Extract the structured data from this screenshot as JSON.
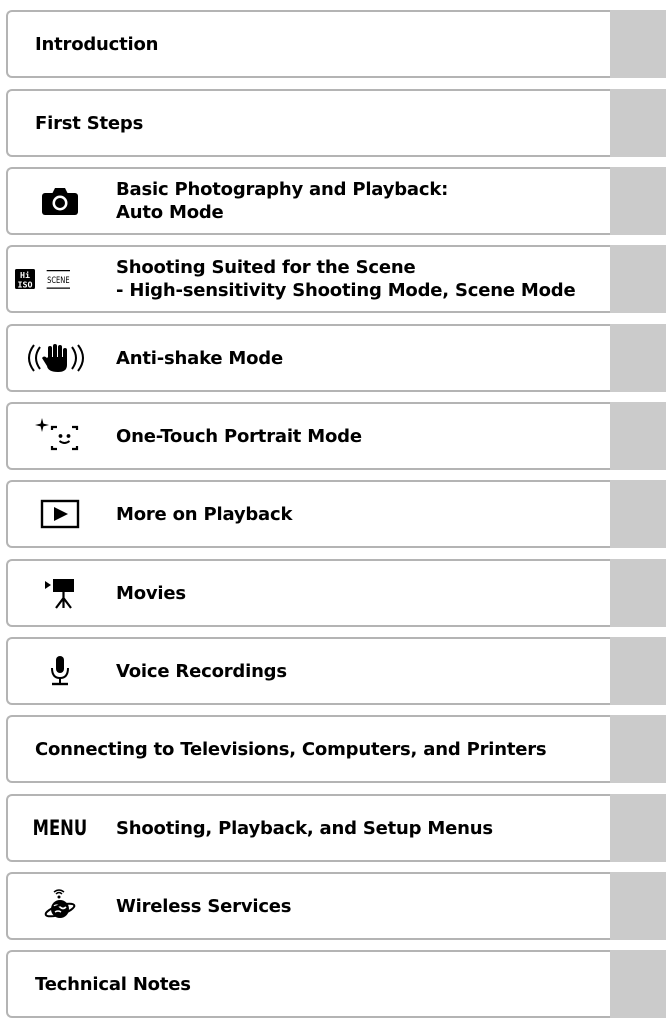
{
  "sections": [
    {
      "label": "Introduction",
      "icon": ""
    },
    {
      "label": "First Steps",
      "icon": ""
    },
    {
      "line1": "Basic Photography and Playback:",
      "line2": "Auto Mode",
      "icon": "camera-icon"
    },
    {
      "line1": "Shooting Suited for the Scene",
      "line2": "- High-sensitivity Shooting Mode, Scene Mode",
      "icon": "hi-iso-scene-icon"
    },
    {
      "label": "Anti-shake Mode",
      "icon": "anti-shake-hand-icon"
    },
    {
      "label": "One-Touch Portrait Mode",
      "icon": "portrait-face-icon"
    },
    {
      "label": "More on Playback",
      "icon": "playback-icon"
    },
    {
      "label": "Movies",
      "icon": "movie-camera-icon"
    },
    {
      "label": "Voice Recordings",
      "icon": "microphone-icon"
    },
    {
      "label": "Connecting to Televisions, Computers, and Printers",
      "icon": ""
    },
    {
      "label": "Shooting, Playback, and Setup Menus",
      "icon": "menu-icon",
      "icon_text": "MENU"
    },
    {
      "label": "Wireless Services",
      "icon": "wireless-globe-icon"
    },
    {
      "label": "Technical Notes",
      "icon": ""
    }
  ]
}
